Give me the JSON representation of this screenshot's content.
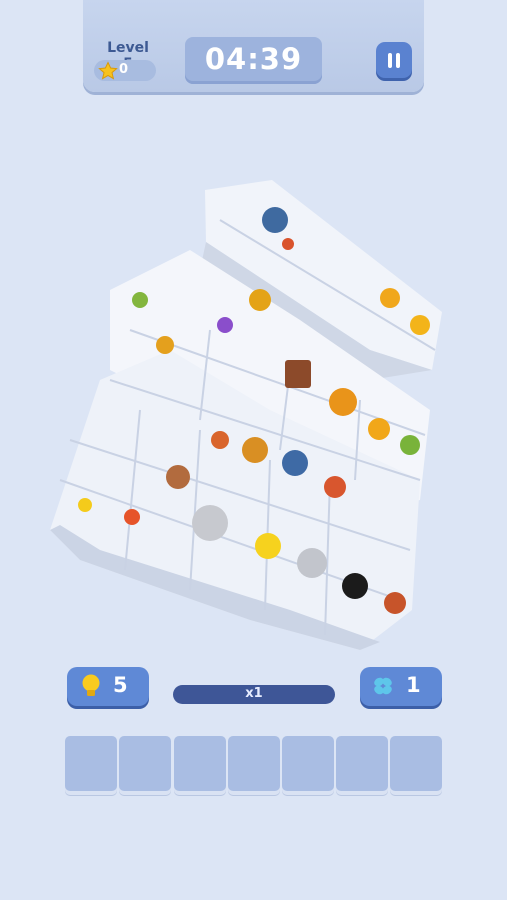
{
  "header": {
    "level_label": "Level 5",
    "stars_count": "0",
    "timer": "04:39"
  },
  "boosters": {
    "hint_count": "5",
    "shuffle_count": "1"
  },
  "combo": {
    "label": "x1"
  },
  "tray": {
    "slot_count": 7,
    "filled": 0
  },
  "colors": {
    "background": "#dce5f5",
    "header_panel": "#bfcfea",
    "accent_blue": "#5f89d6",
    "combo_bar": "#3e5697",
    "tray_slot": "#a9bde3"
  }
}
